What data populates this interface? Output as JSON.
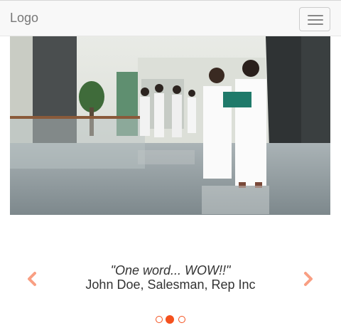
{
  "navbar": {
    "brand": "Logo",
    "toggle_icon": "hamburger-menu-icon"
  },
  "carousel": {
    "image_alt": "Hospital corridor with medical staff in white uniforms",
    "slide": {
      "quote": "\"One word... WOW!!\"",
      "author": "John Doe, Salesman, Rep Inc"
    },
    "prev_icon": "chevron-left-icon",
    "next_icon": "chevron-right-icon",
    "indicators": {
      "count": 3,
      "active_index": 1
    }
  },
  "colors": {
    "accent": "#f4511e",
    "navbar_bg": "#f8f8f8",
    "brand_text": "#777777",
    "text": "#333333"
  }
}
